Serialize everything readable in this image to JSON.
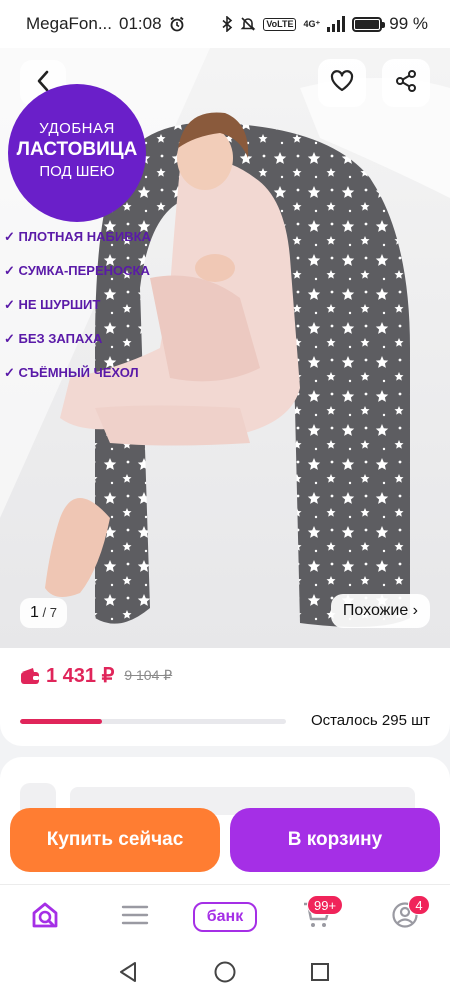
{
  "status_bar": {
    "carrier": "MegaFon...",
    "time": "01:08",
    "network": "4G⁺",
    "volte": "VoLTE",
    "battery_percent_label": "99 %",
    "battery_level": 0.99,
    "icons": [
      "alarm-icon",
      "bluetooth-icon",
      "mute-icon",
      "volte-icon",
      "signal-icon",
      "battery-icon"
    ]
  },
  "gallery": {
    "promo": {
      "line1": "УДОБНАЯ",
      "line2": "ЛАСТОВИЦА",
      "line3": "ПОД ШЕЮ"
    },
    "features": [
      "✓ ПЛОТНАЯ НАБИВКА",
      "✓ СУМКА-ПЕРЕНОСКА",
      "✓ НЕ ШУРШИТ",
      "✓ БЕЗ ЗАПАХА",
      "✓ СЪЁМНЫЙ ЧЕХОЛ"
    ],
    "current_index": "1",
    "total": "7",
    "similar_label": "Похожие ›"
  },
  "product": {
    "price": "1 431 ₽",
    "old_price": "9 104 ₽",
    "stock_fraction": 0.31,
    "stock_label": "Осталось 295 шт"
  },
  "actions": {
    "buy_now": "Купить сейчас",
    "add_to_cart": "В корзину"
  },
  "tabbar": {
    "bank_label": "банк",
    "cart_badge": "99+",
    "profile_badge": "4"
  },
  "colors": {
    "accent_purple": "#a52fe6",
    "buy_orange": "#ff7d32",
    "price_red": "#e0255a",
    "promo_purple": "#6a1fc9"
  }
}
